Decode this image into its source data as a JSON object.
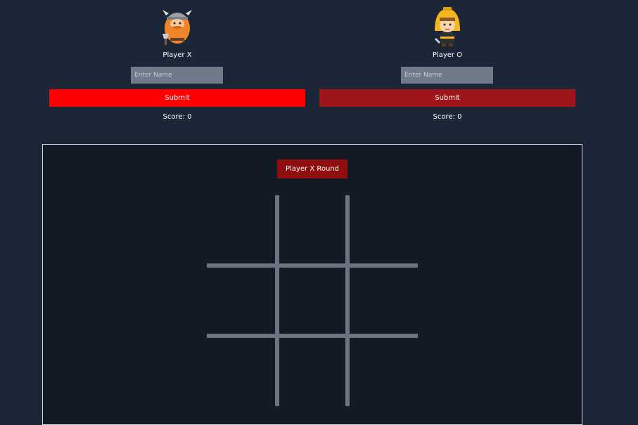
{
  "players": [
    {
      "id": "x",
      "label": "Player X",
      "avatar_icon": "viking-warrior-icon",
      "name_placeholder": "Enter Name",
      "name_value": "",
      "submit_label": "Submit",
      "score_text": "Score: 0",
      "submit_color": "#ff0000"
    },
    {
      "id": "o",
      "label": "Player O",
      "avatar_icon": "hooded-warrior-icon",
      "name_placeholder": "Enter Name",
      "name_value": "",
      "submit_label": "Submit",
      "score_text": "Score: 0",
      "submit_color": "#9e1419"
    }
  ],
  "game": {
    "round_label": "Player X Round",
    "cells": [
      "",
      "",
      "",
      "",
      "",
      "",
      "",
      "",
      ""
    ]
  },
  "colors": {
    "background": "#1c2636",
    "board_background": "#121a26",
    "grid_line": "#6b7480",
    "round_badge": "#8f0d0d",
    "input_background": "#6f7b88"
  }
}
